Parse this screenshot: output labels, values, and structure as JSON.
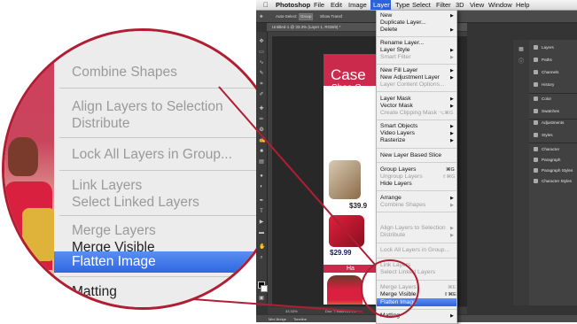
{
  "menubar": {
    "app": "Photoshop",
    "items": [
      "File",
      "Edit",
      "Image",
      "Layer",
      "Type",
      "Select",
      "Filter",
      "3D",
      "View",
      "Window",
      "Help"
    ],
    "active": "Layer"
  },
  "options_bar": {
    "auto_select": "Auto-Select:",
    "group": "Group",
    "show_transform": "Show Transf"
  },
  "document_tab": "Untitled-1 @ 33.3% (Layer 1, RGB/8) *",
  "document": {
    "title": "Case",
    "subtitle": "Shoe O",
    "price1": "$39.9",
    "price2": "$29.99",
    "band_text": "Ha"
  },
  "status": {
    "zoom": "33.33%",
    "doc": "Doc: 7.93M/101.4M"
  },
  "bottom_tabs": [
    "Mini Bridge",
    "Timeline"
  ],
  "panels": [
    "Layers",
    "Paths",
    "Channels",
    "History",
    "Color",
    "Swatches",
    "Adjustments",
    "Styles",
    "Character",
    "Paragraph",
    "Paragraph Styles",
    "Character Styles"
  ],
  "layer_menu": {
    "items": [
      {
        "label": "New",
        "arrow": true
      },
      {
        "label": "Duplicate Layer..."
      },
      {
        "label": "Delete",
        "arrow": true
      },
      {
        "label": "Rename Layer..."
      },
      {
        "label": "Layer Style",
        "arrow": true
      },
      {
        "label": "Smart Filter",
        "arrow": true,
        "dim": true
      },
      {
        "label": "New Fill Layer",
        "arrow": true
      },
      {
        "label": "New Adjustment Layer",
        "arrow": true
      },
      {
        "label": "Layer Content Options...",
        "dim": true
      },
      {
        "label": "Layer Mask",
        "arrow": true
      },
      {
        "label": "Vector Mask",
        "arrow": true
      },
      {
        "label": "Create Clipping Mask",
        "shortcut": "⌥⌘G",
        "dim": true
      },
      {
        "label": "Smart Objects",
        "arrow": true
      },
      {
        "label": "Video Layers",
        "arrow": true
      },
      {
        "label": "Rasterize",
        "arrow": true
      },
      {
        "label": "New Layer Based Slice"
      },
      {
        "label": "Group Layers",
        "shortcut": "⌘G"
      },
      {
        "label": "Ungroup Layers",
        "shortcut": "⇧⌘G",
        "dim": true
      },
      {
        "label": "Hide Layers"
      },
      {
        "label": "Arrange",
        "arrow": true
      },
      {
        "label": "Combine Shapes",
        "arrow": true,
        "dim": true
      },
      {
        "label": "Align Layers to Selection",
        "arrow": true,
        "dim": true
      },
      {
        "label": "Distribute",
        "arrow": true,
        "dim": true
      },
      {
        "label": "Lock All Layers in Group...",
        "dim": true
      },
      {
        "label": "Link Layers",
        "dim": true
      },
      {
        "label": "Select Linked Layers",
        "dim": true
      },
      {
        "label": "Merge Layers",
        "shortcut": "⌘E",
        "dim": true
      },
      {
        "label": "Merge Visible",
        "shortcut": "⇧⌘E"
      },
      {
        "label": "Flatten Image",
        "highlighted": true
      },
      {
        "label": "Matting",
        "arrow": true
      }
    ]
  },
  "magnifier": {
    "items": [
      "Combine Shapes",
      "Align Layers to Selection",
      "Distribute",
      "Lock All Layers in Group...",
      "Link Layers",
      "Select Linked Layers",
      "Merge Layers",
      "Merge Visible",
      "Flatten Image",
      "Matting"
    ]
  },
  "colors": {
    "highlight": "#2d62dc",
    "callout": "#b01e34",
    "brand": "#cc2a4c"
  }
}
